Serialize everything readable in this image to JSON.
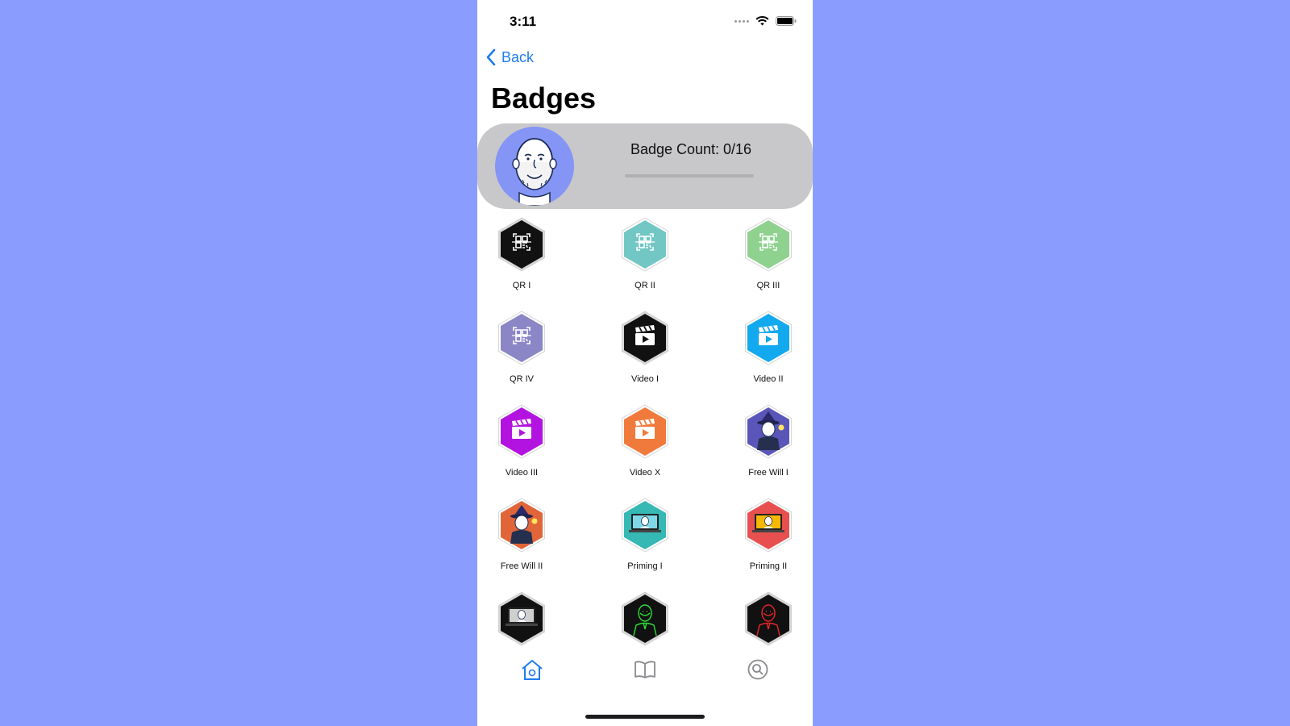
{
  "status_bar": {
    "time": "3:11"
  },
  "nav": {
    "back_label": "Back"
  },
  "page": {
    "title": "Badges"
  },
  "profile": {
    "badge_count_text": "Badge Count: 0/16",
    "progress": 0
  },
  "badges": [
    {
      "label": "QR I",
      "icon": "qr-code-icon",
      "color": "#111111"
    },
    {
      "label": "QR II",
      "icon": "qr-code-icon",
      "color": "#72c7c4"
    },
    {
      "label": "QR III",
      "icon": "qr-code-icon",
      "color": "#8fd18f"
    },
    {
      "label": "QR IV",
      "icon": "qr-code-icon",
      "color": "#8b86c6"
    },
    {
      "label": "Video I",
      "icon": "clapperboard-icon",
      "color": "#111111"
    },
    {
      "label": "Video II",
      "icon": "clapperboard-icon",
      "color": "#12a9ef"
    },
    {
      "label": "Video III",
      "icon": "clapperboard-icon",
      "color": "#b313e0"
    },
    {
      "label": "Video X",
      "icon": "clapperboard-icon",
      "color": "#f07a3c"
    },
    {
      "label": "Free Will I",
      "icon": "wizard-portrait-icon",
      "color": "#5a55b8"
    },
    {
      "label": "Free Will II",
      "icon": "wizard-portrait-icon",
      "color": "#e0663a"
    },
    {
      "label": "Priming I",
      "icon": "monitor-portrait-icon",
      "color": "#36b8b4"
    },
    {
      "label": "Priming II",
      "icon": "monitor-portrait-icon",
      "color": "#e85050"
    },
    {
      "label": "",
      "icon": "monitor-portrait-icon",
      "color": "#111111"
    },
    {
      "label": "",
      "icon": "neon-portrait-icon",
      "color": "#111111"
    },
    {
      "label": "",
      "icon": "neon-portrait-icon",
      "color": "#111111"
    }
  ],
  "tabs": [
    {
      "name": "home",
      "icon": "home-icon",
      "active": true
    },
    {
      "name": "library",
      "icon": "book-icon",
      "active": false
    },
    {
      "name": "search",
      "icon": "search-icon",
      "active": false
    }
  ],
  "colors": {
    "accent": "#1f7cf2",
    "background": "#8a9dff",
    "card": "#c8c8ca"
  }
}
